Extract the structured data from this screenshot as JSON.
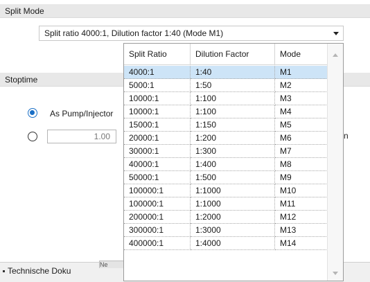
{
  "split_mode": {
    "header": "Split Mode",
    "selected": "Split ratio 4000:1, Dilution factor 1:40 (Mode M1)"
  },
  "stoptime": {
    "header": "Stoptime",
    "radio1_label": "As Pump/Injector",
    "value": "1.00",
    "partial_text": "n"
  },
  "taskbar": {
    "item_label": "Technische Doku",
    "partial_button": "Ne"
  },
  "dropdown": {
    "columns": [
      "Split Ratio",
      "Dilution Factor",
      "Mode"
    ],
    "rows": [
      [
        "4000:1",
        "1:40",
        "M1"
      ],
      [
        "5000:1",
        "1:50",
        "M2"
      ],
      [
        "10000:1",
        "1:100",
        "M3"
      ],
      [
        "10000:1",
        "1:100",
        "M4"
      ],
      [
        "15000:1",
        "1:150",
        "M5"
      ],
      [
        "20000:1",
        "1:200",
        "M6"
      ],
      [
        "30000:1",
        "1:300",
        "M7"
      ],
      [
        "40000:1",
        "1:400",
        "M8"
      ],
      [
        "50000:1",
        "1:500",
        "M9"
      ],
      [
        "100000:1",
        "1:1000",
        "M10"
      ],
      [
        "100000:1",
        "1:1000",
        "M11"
      ],
      [
        "200000:1",
        "1:2000",
        "M12"
      ],
      [
        "300000:1",
        "1:3000",
        "M13"
      ],
      [
        "400000:1",
        "1:4000",
        "M14"
      ]
    ],
    "selected_index": 0
  },
  "colors": {
    "selection": "#cde4f7",
    "radio_accent": "#1a6fc6",
    "section_header": "#e8e8e8"
  },
  "icons": [
    "dropdown-arrow-icon",
    "scroll-up-icon",
    "scroll-down-icon"
  ]
}
